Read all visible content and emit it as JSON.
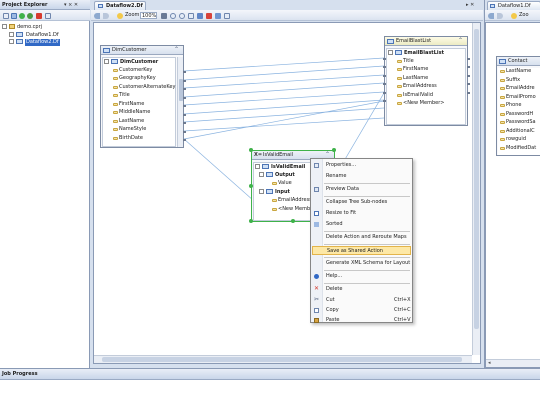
{
  "project_explorer": {
    "title": "Project Explorer",
    "header_buttons": "▾ ⨯ ✕",
    "tree": [
      {
        "label": "demo.cprj"
      },
      {
        "label": "Dataflow1.Df"
      },
      {
        "label": "Dataflow2.Df"
      }
    ]
  },
  "editor": {
    "tab": "Dataflow2.Df",
    "zoom_label": "Zoom",
    "zoom_value": "100%",
    "window_buttons": "▸ ✕"
  },
  "right_editor": {
    "tab": "Dataflow1.Df",
    "zoom_label": "Zoo",
    "contact_node": {
      "title": "Contact",
      "fields": [
        "LastName",
        "Suffix",
        "EmailAddre",
        "EmailPromo",
        "Phone",
        "PasswordH",
        "PasswordSa",
        "AdditionalC",
        "rowguid",
        "ModifiedDat"
      ]
    }
  },
  "dim_customer": {
    "title": "DimCustomer",
    "table": "DimCustomer",
    "fields": [
      "CustomerKey",
      "GeographyKey",
      "CustomerAlternateKey",
      "Title",
      "FirstName",
      "MiddleName",
      "LastName",
      "NameStyle",
      "BirthDate"
    ]
  },
  "email_blastlist": {
    "title": "EmailBlastList",
    "table": "EmailBlastList",
    "fields": [
      "Title",
      "FirstName",
      "LastName",
      "EmailAddress",
      "IsEmailValid",
      "<New Member>"
    ]
  },
  "is_valid_email": {
    "title": "IsValidEmail",
    "table": "IsValidEmail",
    "output_label": "Output",
    "output_value": "Value",
    "input_label": "Input",
    "input_fields": [
      "EmailAddress",
      "<New Member>"
    ]
  },
  "context_menu": {
    "items": [
      {
        "label": "Properties...",
        "shortcut": ""
      },
      {
        "label": "Rename",
        "shortcut": ""
      },
      {
        "label": "Preview Data",
        "shortcut": ""
      },
      {
        "label": "Collapse Tree Sub-nodes",
        "shortcut": ""
      },
      {
        "label": "Resize to Fit",
        "shortcut": ""
      },
      {
        "label": "Sorted",
        "shortcut": ""
      },
      {
        "label": "Delete Action and Reroute Maps",
        "shortcut": ""
      },
      {
        "label": "Save as Shared Action",
        "shortcut": ""
      },
      {
        "label": "Generate XML Schema for Layout",
        "shortcut": ""
      },
      {
        "label": "Help...",
        "shortcut": ""
      },
      {
        "label": "Delete",
        "shortcut": ""
      },
      {
        "label": "Cut",
        "shortcut": "Ctrl+X"
      },
      {
        "label": "Copy",
        "shortcut": "Ctrl+C"
      },
      {
        "label": "Paste",
        "shortcut": "Ctrl+V"
      }
    ]
  },
  "job_progress": {
    "title": "Job Progress"
  },
  "colors": {
    "accent": "#3169c6",
    "menu_highlight": "#fde8a6",
    "mapping_line": "#8ab3e0",
    "selection_handle": "#3fb24a"
  },
  "icons": [
    "save-icon",
    "refresh-icon",
    "zoom-icon",
    "run-icon",
    "help-icon",
    "delete-icon",
    "cut-icon",
    "copy-icon",
    "paste-icon",
    "table-icon",
    "field-icon"
  ]
}
